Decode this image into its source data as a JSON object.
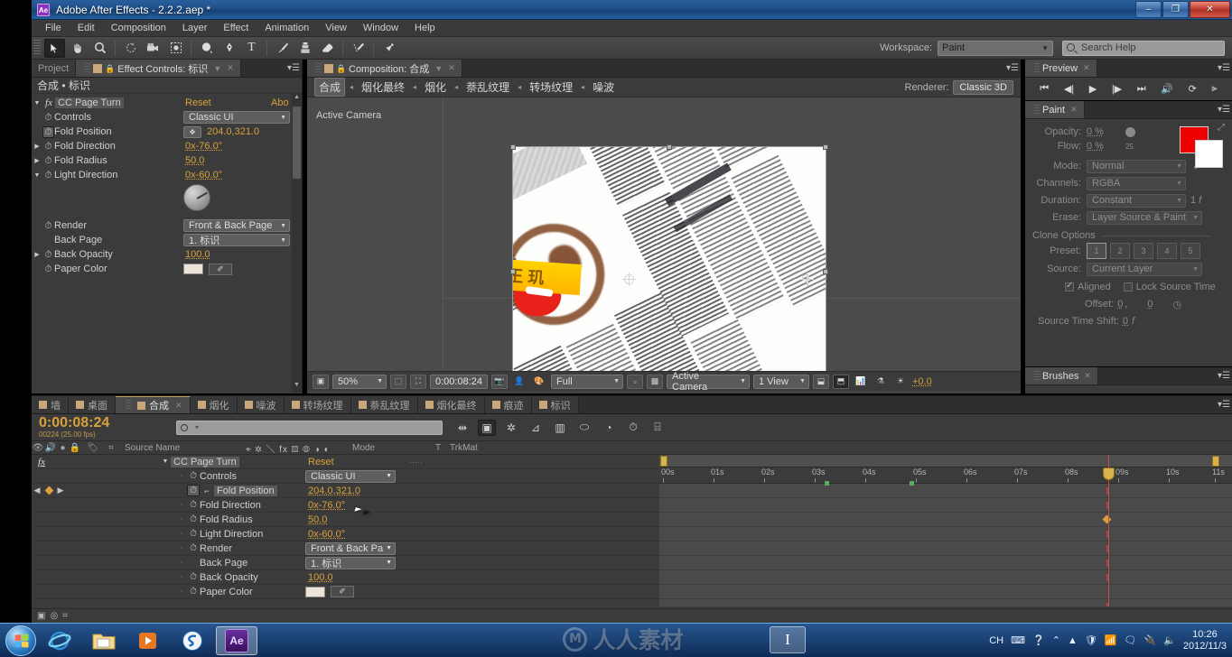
{
  "window": {
    "title": "Adobe After Effects - 2.2.2.aep *",
    "app_badge": "Ae",
    "minimize": "–",
    "maximize": "❐",
    "close": "✕"
  },
  "menu": [
    "File",
    "Edit",
    "Composition",
    "Layer",
    "Effect",
    "Animation",
    "View",
    "Window",
    "Help"
  ],
  "toolbar": {
    "workspace_label": "Workspace:",
    "workspace_value": "Paint",
    "search_placeholder": "Search Help",
    "tools": [
      {
        "name": "selection-tool",
        "glyph": "➤",
        "active": true
      },
      {
        "name": "hand-tool",
        "glyph": "✋",
        "active": false
      },
      {
        "name": "zoom-tool",
        "glyph": "🔍",
        "active": false
      },
      {
        "name": "rotation-tool",
        "glyph": "↻",
        "active": false
      },
      {
        "name": "camera-tool",
        "glyph": "🎥",
        "active": false
      },
      {
        "name": "pan-behind-tool",
        "glyph": "✥",
        "active": false
      },
      {
        "name": "shape-tool",
        "glyph": "●",
        "active": false
      },
      {
        "name": "pen-tool",
        "glyph": "✒",
        "active": false
      },
      {
        "name": "type-tool",
        "glyph": "T",
        "active": false
      },
      {
        "name": "brush-tool",
        "glyph": "🖌",
        "active": false
      },
      {
        "name": "clone-stamp-tool",
        "glyph": "⎈",
        "active": false
      },
      {
        "name": "eraser-tool",
        "glyph": "◺",
        "active": false
      },
      {
        "name": "roto-brush-tool",
        "glyph": "⌁",
        "active": false
      },
      {
        "name": "puppet-pin-tool",
        "glyph": "📌",
        "active": false
      }
    ]
  },
  "effect_controls": {
    "tab_project": "Project",
    "tab_title": "Effect Controls: 标识",
    "tab_close": "✕",
    "header": "合成 • 标识",
    "effect_name": "CC Page Turn",
    "reset": "Reset",
    "about": "Abo",
    "properties": [
      {
        "name": "Controls",
        "type": "dropdown",
        "value": "Classic UI",
        "tri": "",
        "stopwatch": true
      },
      {
        "name": "Fold Position",
        "type": "position",
        "value": "204.0,321.0",
        "tri": "",
        "stopwatch": true
      },
      {
        "name": "Fold Direction",
        "type": "value",
        "value": "0x-76.0°",
        "tri": "▶",
        "stopwatch": true
      },
      {
        "name": "Fold Radius",
        "type": "value",
        "value": "50.0",
        "tri": "▶",
        "stopwatch": true
      },
      {
        "name": "Light Direction",
        "type": "value",
        "value": "0x-60.0°",
        "tri": "▼",
        "stopwatch": true
      },
      {
        "name": "Render",
        "type": "dropdown",
        "value": "Front & Back Page",
        "tri": "",
        "stopwatch": true
      },
      {
        "name": "Back Page",
        "type": "dropdown",
        "value": "1. 标识",
        "tri": "",
        "stopwatch": false
      },
      {
        "name": "Back Opacity",
        "type": "value",
        "value": "100.0",
        "tri": "▶",
        "stopwatch": true
      },
      {
        "name": "Paper Color",
        "type": "color",
        "value": "#ece4d8",
        "tri": "",
        "stopwatch": true
      }
    ]
  },
  "composition": {
    "tab_title": "Composition: 合成",
    "tab_close": "✕",
    "breadcrumb": [
      "合成",
      "烟化最终",
      "烟化",
      "萘乱纹理",
      "转场纹理",
      "噪波"
    ],
    "breadcrumb_sep": "◂",
    "renderer_label": "Renderer:",
    "renderer_value": "Classic 3D",
    "active_camera_label": "Active Camera",
    "viewer_toolbar": {
      "zoom": "50%",
      "time": "0:00:08:24",
      "resolution": "Full",
      "camera": "Active Camera",
      "views": "1 View",
      "exposure": "+0.0"
    }
  },
  "preview": {
    "tab": "Preview",
    "tab_close": "✕",
    "buttons": [
      "⏮",
      "◀|",
      "▶",
      "|▶",
      "⏭",
      "🔊",
      "⟳",
      "⫸"
    ]
  },
  "paint": {
    "tab": "Paint",
    "tab_close": "✕",
    "opacity_label": "Opacity:",
    "opacity_value": "0 %",
    "flow_label": "Flow:",
    "flow_value": "0 %",
    "brush_size": "25",
    "mode_label": "Mode:",
    "mode_value": "Normal",
    "channels_label": "Channels:",
    "channels_value": "RGBA",
    "duration_label": "Duration:",
    "duration_value": "Constant",
    "duration_frames": "1",
    "duration_unit": "f",
    "erase_label": "Erase:",
    "erase_value": "Layer Source & Paint",
    "foreground_color": "#ee0000",
    "background_color": "#ffffff",
    "clone_options_title": "Clone Options",
    "preset_label": "Preset:",
    "presets": [
      "1",
      "2",
      "3",
      "4",
      "5"
    ],
    "source_label": "Source:",
    "source_value": "Current Layer",
    "aligned_label": "Aligned",
    "aligned_checked": true,
    "lock_source_time_label": "Lock Source Time",
    "lock_source_time_checked": false,
    "offset_label": "Offset:",
    "offset_x": "0",
    "offset_y": "0",
    "source_time_shift_label": "Source Time Shift:",
    "source_time_shift_value": "0",
    "source_time_shift_unit": "f"
  },
  "brushes": {
    "tab": "Brushes",
    "tab_close": "✕"
  },
  "timeline": {
    "tabs": [
      {
        "label": "墙",
        "active": false
      },
      {
        "label": "桌面",
        "active": false
      },
      {
        "label": "合成",
        "active": true
      },
      {
        "label": "烟化",
        "active": false
      },
      {
        "label": "噪波",
        "active": false
      },
      {
        "label": "转场纹理",
        "active": false
      },
      {
        "label": "萘乱纹理",
        "active": false
      },
      {
        "label": "烟化最终",
        "active": false
      },
      {
        "label": "痕迹",
        "active": false
      },
      {
        "label": "标识",
        "active": false
      }
    ],
    "current_time": "0:00:08:24",
    "frame_info": "00224 (25.00 fps)",
    "search_placeholder": "",
    "columns": {
      "source_name": "Source Name",
      "mode": "Mode",
      "t": "T",
      "trkmat": "TrkMat",
      "switches": "⌗"
    },
    "effect_label": "fx",
    "layer_name": "CC Page Turn",
    "reset": "Reset",
    "rows": [
      {
        "name": "CC Page Turn",
        "type": "header",
        "value": "Reset"
      },
      {
        "name": "Controls",
        "type": "dropdown",
        "value": "Classic UI"
      },
      {
        "name": "Fold Position",
        "type": "position",
        "value": "204.0,321.0",
        "selected": true,
        "keyframed": true
      },
      {
        "name": "Fold Direction",
        "type": "value",
        "value": "0x-76.0°"
      },
      {
        "name": "Fold Radius",
        "type": "value",
        "value": "50.0"
      },
      {
        "name": "Light Direction",
        "type": "value",
        "value": "0x-60.0°"
      },
      {
        "name": "Render",
        "type": "dropdown",
        "value": "Front & Back Pa"
      },
      {
        "name": "Back Page",
        "type": "dropdown",
        "value": "1. 标识"
      },
      {
        "name": "Back Opacity",
        "type": "value",
        "value": "100.0"
      },
      {
        "name": "Paper Color",
        "type": "color",
        "value": "#ece4d8"
      }
    ],
    "ruler_ticks": [
      "00s",
      "01s",
      "02s",
      "03s",
      "04s",
      "05s",
      "06s",
      "07s",
      "08s",
      "09s",
      "10s",
      "11s"
    ],
    "playhead_time": "09s"
  },
  "taskbar": {
    "start": "Start",
    "items": [
      {
        "name": "internet-explorer",
        "glyph": "e"
      },
      {
        "name": "file-explorer",
        "glyph": "🗂"
      },
      {
        "name": "media-player",
        "glyph": "▶"
      },
      {
        "name": "sogou-input",
        "glyph": "S"
      },
      {
        "name": "after-effects",
        "glyph": "Ae",
        "active": true
      }
    ],
    "tray": {
      "input_method": "CH",
      "clock_time": "10:26",
      "clock_date": "2012/11/3"
    }
  },
  "watermark": {
    "text": "人人素材",
    "mark": "M"
  }
}
